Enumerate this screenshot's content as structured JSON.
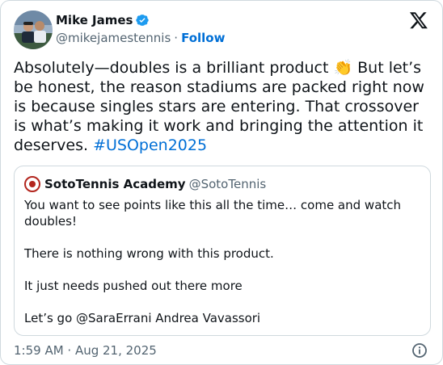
{
  "author": {
    "name": "Mike James",
    "handle": "@mikejamestennis",
    "separator": "·",
    "follow_label": "Follow"
  },
  "tweet": {
    "text_before": "Absolutely—doubles is a brilliant product ",
    "emoji": "👏",
    "text_after": " But let’s be honest, the reason stadiums are packed right now is because singles stars are entering. That crossover is what’s making it work and bringing the attention it deserves. ",
    "hashtag": "#USOpen2025"
  },
  "quoted": {
    "name": "SotoTennis Academy",
    "handle": "@SotoTennis",
    "text": "You want to see points like this all the time… come and watch doubles!\n\nThere is nothing wrong with this product.\n\nIt just needs pushed out there more\n\nLet’s go @SaraErrani Andrea Vavassori"
  },
  "footer": {
    "timestamp": "1:59 AM · Aug 21, 2025"
  },
  "icons": {
    "verified": "verified-badge-icon",
    "platform": "x-logo-icon",
    "info": "info-icon"
  },
  "colors": {
    "link": "#006fd6",
    "muted": "#536471",
    "border": "#cfd9de"
  }
}
